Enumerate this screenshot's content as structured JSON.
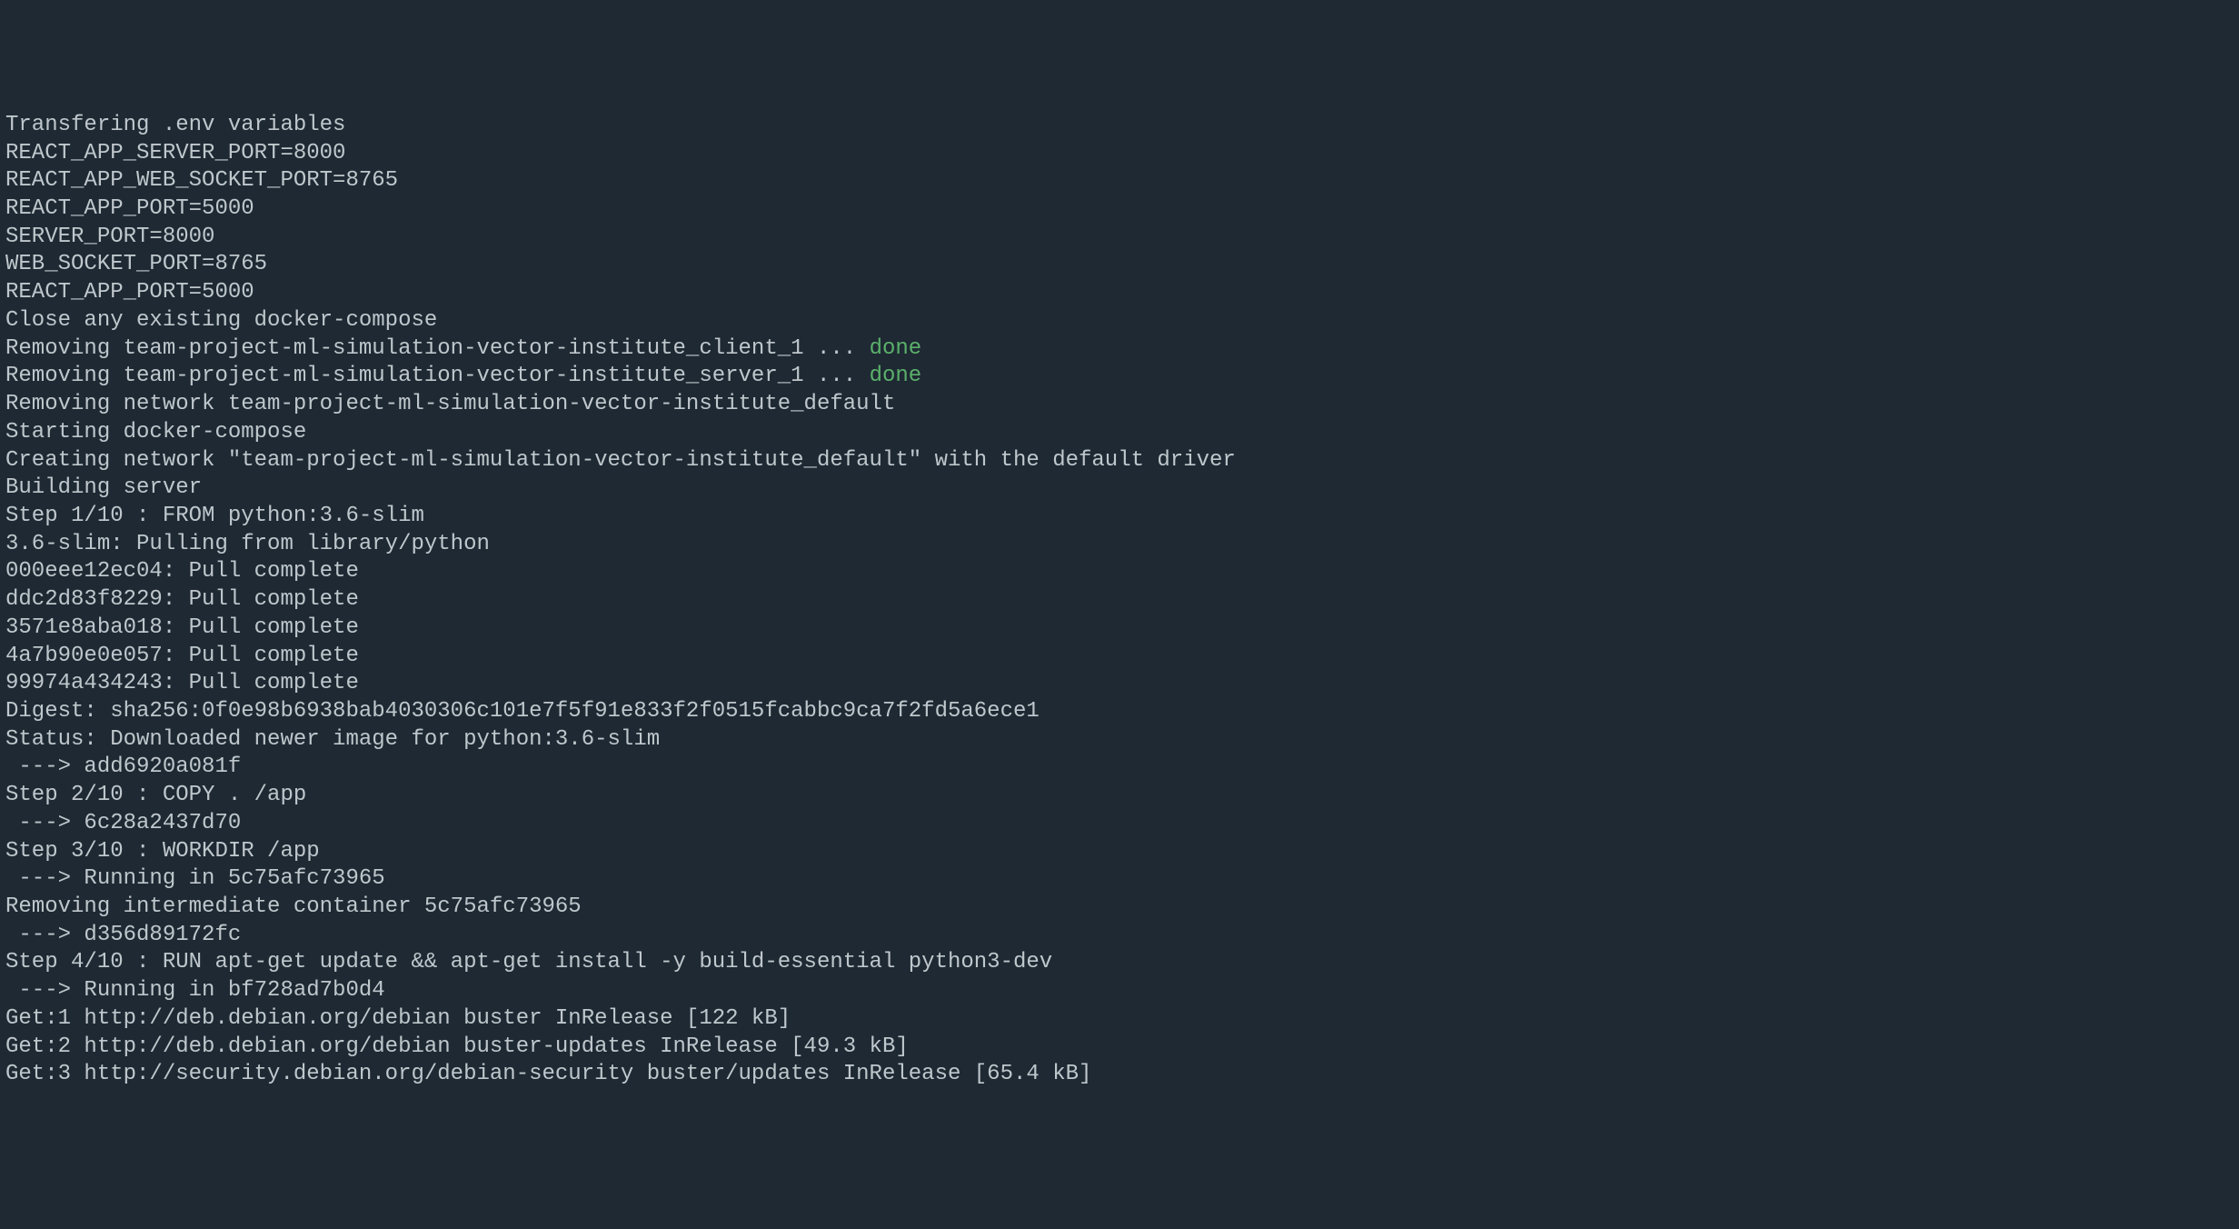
{
  "terminal": {
    "lines": [
      {
        "text": "Transfering .env variables",
        "class": ""
      },
      {
        "text": "REACT_APP_SERVER_PORT=8000",
        "class": ""
      },
      {
        "text": "REACT_APP_WEB_SOCKET_PORT=8765",
        "class": ""
      },
      {
        "text": "REACT_APP_PORT=5000",
        "class": ""
      },
      {
        "text": "SERVER_PORT=8000",
        "class": ""
      },
      {
        "text": "WEB_SOCKET_PORT=8765",
        "class": ""
      },
      {
        "text": "REACT_APP_PORT=5000",
        "class": ""
      },
      {
        "text": "Close any existing docker-compose",
        "class": ""
      },
      {
        "prefix": "Removing team-project-ml-simulation-vector-institute_client_1 ... ",
        "status": "done",
        "class": "has-done"
      },
      {
        "prefix": "Removing team-project-ml-simulation-vector-institute_server_1 ... ",
        "status": "done",
        "class": "has-done"
      },
      {
        "text": "Removing network team-project-ml-simulation-vector-institute_default",
        "class": ""
      },
      {
        "text": "Starting docker-compose",
        "class": ""
      },
      {
        "text": "Creating network \"team-project-ml-simulation-vector-institute_default\" with the default driver",
        "class": ""
      },
      {
        "text": "Building server",
        "class": ""
      },
      {
        "text": "Step 1/10 : FROM python:3.6-slim",
        "class": ""
      },
      {
        "text": "3.6-slim: Pulling from library/python",
        "class": ""
      },
      {
        "text": "000eee12ec04: Pull complete",
        "class": ""
      },
      {
        "text": "ddc2d83f8229: Pull complete",
        "class": ""
      },
      {
        "text": "3571e8aba018: Pull complete",
        "class": ""
      },
      {
        "text": "4a7b90e0e057: Pull complete",
        "class": ""
      },
      {
        "text": "99974a434243: Pull complete",
        "class": ""
      },
      {
        "text": "Digest: sha256:0f0e98b6938bab4030306c101e7f5f91e833f2f0515fcabbc9ca7f2fd5a6ece1",
        "class": ""
      },
      {
        "text": "Status: Downloaded newer image for python:3.6-slim",
        "class": ""
      },
      {
        "text": " ---> add6920a081f",
        "class": ""
      },
      {
        "text": "Step 2/10 : COPY . /app",
        "class": ""
      },
      {
        "text": " ---> 6c28a2437d70",
        "class": ""
      },
      {
        "text": "Step 3/10 : WORKDIR /app",
        "class": ""
      },
      {
        "text": " ---> Running in 5c75afc73965",
        "class": ""
      },
      {
        "text": "Removing intermediate container 5c75afc73965",
        "class": ""
      },
      {
        "text": " ---> d356d89172fc",
        "class": ""
      },
      {
        "text": "Step 4/10 : RUN apt-get update && apt-get install -y build-essential python3-dev",
        "class": ""
      },
      {
        "text": " ---> Running in bf728ad7b0d4",
        "class": ""
      },
      {
        "text": "Get:1 http://deb.debian.org/debian buster InRelease [122 kB]",
        "class": ""
      },
      {
        "text": "Get:2 http://deb.debian.org/debian buster-updates InRelease [49.3 kB]",
        "class": ""
      },
      {
        "text": "Get:3 http://security.debian.org/debian-security buster/updates InRelease [65.4 kB]",
        "class": ""
      }
    ]
  }
}
